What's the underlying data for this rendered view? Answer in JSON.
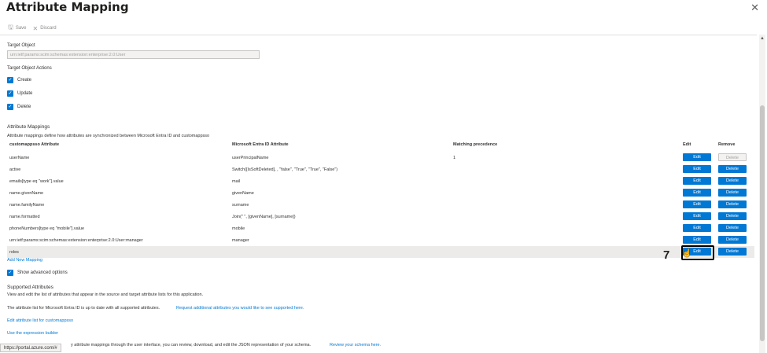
{
  "header": {
    "title": "Attribute Mapping",
    "more": "···",
    "close": "✕"
  },
  "toolbar": {
    "save_label": "Save",
    "discard_label": "Discard"
  },
  "target_object": {
    "label": "Target Object",
    "value": "urn:ietf:params:scim:schemas:extension:enterprise:2.0:User"
  },
  "target_actions": {
    "label": "Target Object Actions",
    "items": [
      {
        "label": "Create",
        "checked": true
      },
      {
        "label": "Update",
        "checked": true
      },
      {
        "label": "Delete",
        "checked": true
      }
    ]
  },
  "mappings": {
    "title": "Attribute Mappings",
    "description": "Attribute mappings define how attributes are synchronized between Microsoft Entra ID and customappsso",
    "columns": [
      "customappsso Attribute",
      "Microsoft Entra ID Attribute",
      "Matching precedence",
      "Edit",
      "Remove"
    ],
    "edit_label": "Edit",
    "delete_label": "Delete",
    "rows": [
      {
        "target": "userName",
        "source": "userPrincipalName",
        "precedence": "1"
      },
      {
        "target": "active",
        "source": "Switch([IsSoftDeleted], , \"false\", \"True\", \"True\", \"False\")",
        "precedence": ""
      },
      {
        "target": "emails[type eq \"work\"].value",
        "source": "mail",
        "precedence": ""
      },
      {
        "target": "name.givenName",
        "source": "givenName",
        "precedence": ""
      },
      {
        "target": "name.familyName",
        "source": "surname",
        "precedence": ""
      },
      {
        "target": "name.formatted",
        "source": "Join(\" \", [givenName], [surname])",
        "precedence": ""
      },
      {
        "target": "phoneNumbers[type eq \"mobile\"].value",
        "source": "mobile",
        "precedence": ""
      },
      {
        "target": "urn:ietf:params:scim:schemas:extension:enterprise:2.0:User:manager",
        "source": "manager",
        "precedence": ""
      },
      {
        "target": "roles",
        "source": "",
        "precedence": ""
      }
    ],
    "add_new": "Add New Mapping",
    "show_advanced": "Show advanced options"
  },
  "annotation": {
    "number": "7"
  },
  "supported": {
    "title": "Supported Attributes",
    "desc": "View and edit the list of attributes that appear in the source and target attribute lists for this application.",
    "status_text": "The attribute list for Microsoft Entra ID is up to date with all supported attributes.",
    "request_link": "Request additional attributes you would like to see supported here.",
    "edit_list_link": "Edit attribute list for customappsso",
    "expression_link": "Use the expression builder",
    "bottom_text": "y attribute mappings through the user interface, you can review, download, and edit the JSON representation of your schema.",
    "review_link": "Review your schema here."
  },
  "statusbar": {
    "url": "https://portal.azure.com/#"
  },
  "colors": {
    "accent": "#0078d4",
    "highlight": "#edebe9"
  }
}
